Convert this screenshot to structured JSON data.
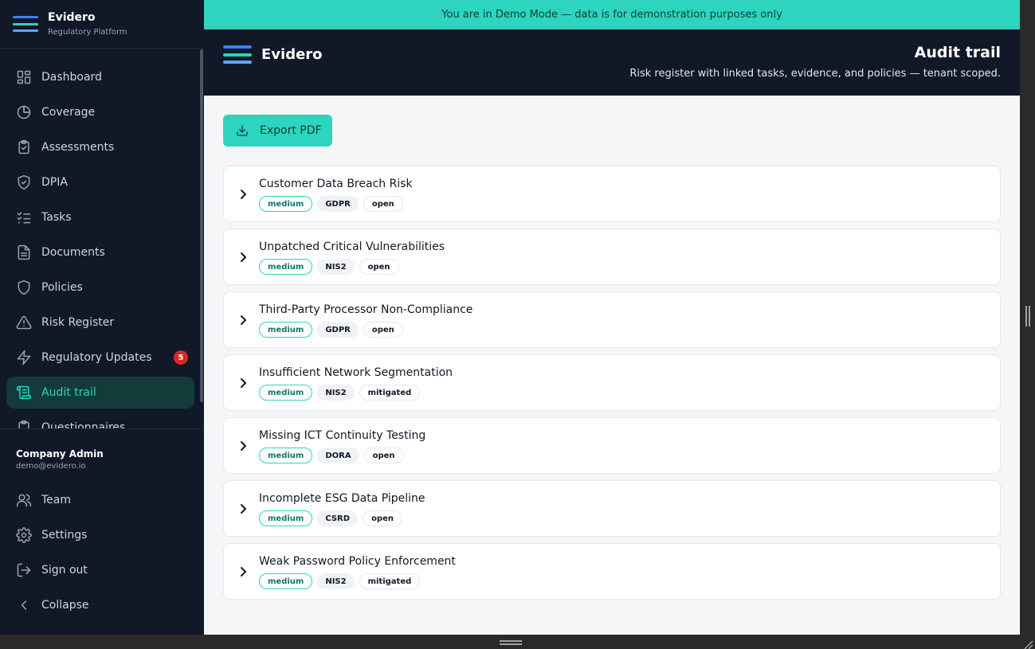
{
  "brand": {
    "name": "Evidero",
    "subtitle": "Regulatory Platform"
  },
  "sidebar": {
    "items": [
      {
        "label": "Dashboard",
        "icon": "dashboard-icon"
      },
      {
        "label": "Coverage",
        "icon": "pie-chart-icon"
      },
      {
        "label": "Assessments",
        "icon": "clipboard-check-icon"
      },
      {
        "label": "DPIA",
        "icon": "shield-check-icon"
      },
      {
        "label": "Tasks",
        "icon": "list-checks-icon"
      },
      {
        "label": "Documents",
        "icon": "file-text-icon"
      },
      {
        "label": "Policies",
        "icon": "shield-icon"
      },
      {
        "label": "Risk Register",
        "icon": "alert-triangle-icon"
      },
      {
        "label": "Regulatory Updates",
        "icon": "zap-icon",
        "badge": "5"
      },
      {
        "label": "Audit trail",
        "icon": "scroll-icon",
        "active": true
      },
      {
        "label": "Questionnaires",
        "icon": "clipboard-icon"
      }
    ],
    "user": {
      "name": "Company Admin",
      "email": "demo@evidero.io"
    },
    "bottom_items": [
      {
        "label": "Team",
        "icon": "users-icon"
      },
      {
        "label": "Settings",
        "icon": "gear-icon"
      },
      {
        "label": "Sign out",
        "icon": "log-out-icon"
      },
      {
        "label": "Collapse",
        "icon": "chevron-left-icon"
      }
    ]
  },
  "banner": {
    "text": "You are in Demo Mode — data is for demonstration purposes only"
  },
  "header": {
    "logo_text": "Evidero",
    "title": "Audit trail",
    "subtitle": "Risk register with linked tasks, evidence, and policies — tenant scoped."
  },
  "toolbar": {
    "export_label": "Export PDF"
  },
  "risks": [
    {
      "title": "Customer Data Breach Risk",
      "severity": "medium",
      "framework": "GDPR",
      "status": "open"
    },
    {
      "title": "Unpatched Critical Vulnerabilities",
      "severity": "medium",
      "framework": "NIS2",
      "status": "open"
    },
    {
      "title": "Third-Party Processor Non-Compliance",
      "severity": "medium",
      "framework": "GDPR",
      "status": "open"
    },
    {
      "title": "Insufficient Network Segmentation",
      "severity": "medium",
      "framework": "NIS2",
      "status": "mitigated"
    },
    {
      "title": "Missing ICT Continuity Testing",
      "severity": "medium",
      "framework": "DORA",
      "status": "open"
    },
    {
      "title": "Incomplete ESG Data Pipeline",
      "severity": "medium",
      "framework": "CSRD",
      "status": "open"
    },
    {
      "title": "Weak Password Policy Enforcement",
      "severity": "medium",
      "framework": "NIS2",
      "status": "mitigated"
    }
  ],
  "colors": {
    "accent": "#2dd4bf",
    "sidebar_bg": "#111827",
    "badge": "#dc2626",
    "logo_bar_top": "#3b82f6",
    "logo_bar_mid": "#2dd4bf",
    "logo_bar_bottom": "#60a5fa"
  }
}
